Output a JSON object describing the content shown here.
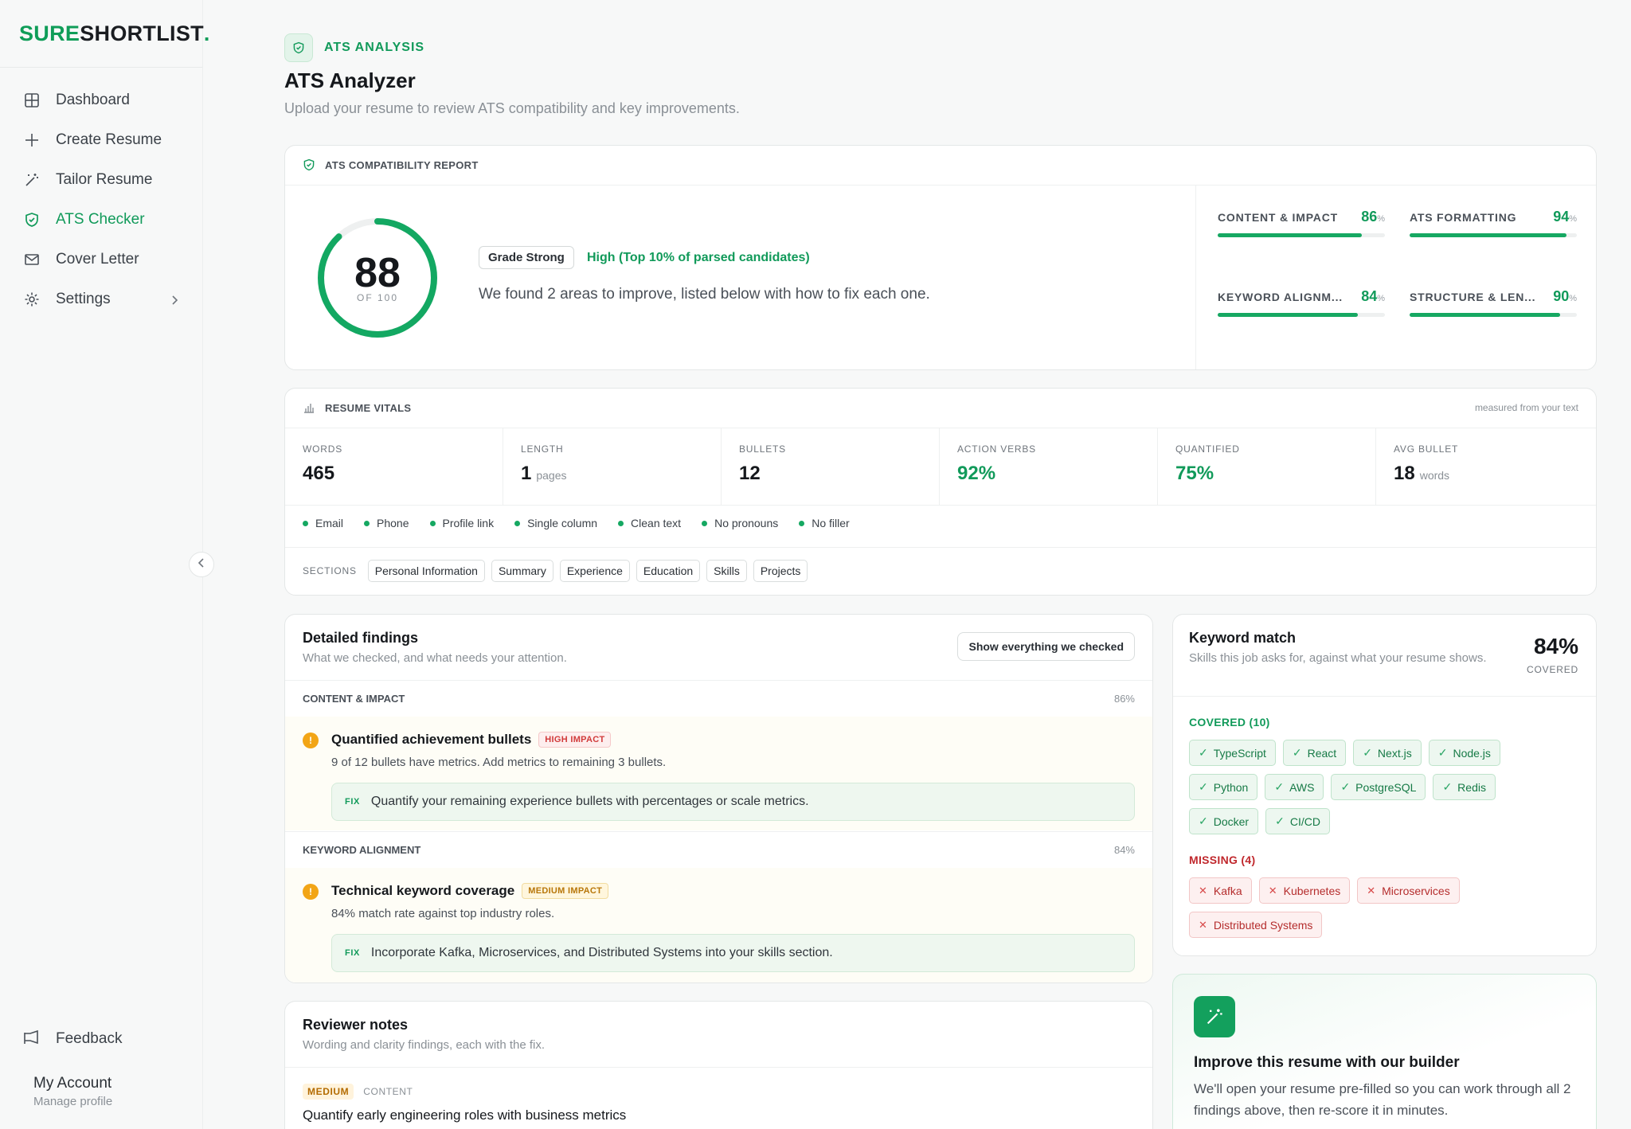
{
  "brand": {
    "part1": "SURE",
    "part2": "SHORTLIST",
    "dot": "."
  },
  "nav": [
    {
      "label": "Dashboard",
      "icon": "grid-icon"
    },
    {
      "label": "Create Resume",
      "icon": "plus-icon"
    },
    {
      "label": "Tailor Resume",
      "icon": "wand-icon"
    },
    {
      "label": "ATS Checker",
      "icon": "shield-icon",
      "active": true
    },
    {
      "label": "Cover Letter",
      "icon": "mail-icon"
    },
    {
      "label": "Settings",
      "icon": "gear-icon"
    }
  ],
  "sidebar_bottom": {
    "feedback": "Feedback",
    "account_title": "My Account",
    "account_sub": "Manage profile"
  },
  "header": {
    "kicker": "ATS ANALYSIS",
    "title": "ATS Analyzer",
    "subtitle": "Upload your resume to review ATS compatibility and key improvements."
  },
  "report": {
    "heading": "ATS COMPATIBILITY REPORT",
    "score": "88",
    "score_value": 88,
    "score_of": "OF 100",
    "grade": "Grade Strong",
    "grade_note": "High (Top 10% of parsed candidates)",
    "summary": "We found 2 areas to improve, listed below with how to fix each one.",
    "metrics": [
      {
        "label": "CONTENT & IMPACT",
        "value": "86",
        "pct": 86
      },
      {
        "label": "ATS FORMATTING",
        "value": "94",
        "pct": 94
      },
      {
        "label": "KEYWORD ALIGNM...",
        "value": "84",
        "pct": 84
      },
      {
        "label": "STRUCTURE & LEN...",
        "value": "90",
        "pct": 90
      }
    ],
    "percent_sign": "%"
  },
  "vitals": {
    "heading": "RESUME VITALS",
    "measured": "measured from your text",
    "cells": [
      {
        "label": "WORDS",
        "value": "465",
        "unit": ""
      },
      {
        "label": "LENGTH",
        "value": "1",
        "unit": "pages"
      },
      {
        "label": "BULLETS",
        "value": "12",
        "unit": ""
      },
      {
        "label": "ACTION VERBS",
        "value": "92%",
        "unit": ""
      },
      {
        "label": "QUANTIFIED",
        "value": "75%",
        "unit": ""
      },
      {
        "label": "AVG BULLET",
        "value": "18",
        "unit": "words"
      }
    ],
    "checks": [
      "Email",
      "Phone",
      "Profile link",
      "Single column",
      "Clean text",
      "No pronouns",
      "No filler"
    ],
    "sections_label": "SECTIONS",
    "sections": [
      "Personal Information",
      "Summary",
      "Experience",
      "Education",
      "Skills",
      "Projects"
    ]
  },
  "findings": {
    "title": "Detailed findings",
    "subtitle": "What we checked, and what needs your attention.",
    "button": "Show everything we checked",
    "groups": [
      {
        "section": "CONTENT & IMPACT",
        "pct": "86%",
        "item": "Quantified achievement bullets",
        "impact": "HIGH IMPACT",
        "desc": "9 of 12 bullets have metrics. Add metrics to remaining 3 bullets.",
        "fix_label": "FIX",
        "fix": "Quantify your remaining experience bullets with percentages or scale metrics."
      },
      {
        "section": "KEYWORD ALIGNMENT",
        "pct": "84%",
        "item": "Technical keyword coverage",
        "impact": "MEDIUM IMPACT",
        "desc": "84% match rate against top industry roles.",
        "fix_label": "FIX",
        "fix": "Incorporate Kafka, Microservices, and Distributed Systems into your skills section."
      }
    ]
  },
  "keywords": {
    "title": "Keyword match",
    "subtitle": "Skills this job asks for, against what your resume shows.",
    "percent": "84%",
    "covered_label": "COVERED",
    "covered_heading": "COVERED (10)",
    "covered": [
      "TypeScript",
      "React",
      "Next.js",
      "Node.js",
      "Python",
      "AWS",
      "PostgreSQL",
      "Redis",
      "Docker",
      "CI/CD"
    ],
    "missing_heading": "MISSING (4)",
    "missing": [
      "Kafka",
      "Kubernetes",
      "Microservices",
      "Distributed Systems"
    ]
  },
  "notes": {
    "title": "Reviewer notes",
    "subtitle": "Wording and clarity findings, each with the fix.",
    "severity": "MEDIUM",
    "category": "CONTENT",
    "headline": "Quantify early engineering roles with business metrics"
  },
  "improve": {
    "title": "Improve this resume with our builder",
    "desc": "We'll open your resume pre-filled so you can work through all 2 findings above, then re-score it in minutes."
  },
  "colors": {
    "accent": "#119a5a",
    "warning": "#f2a516",
    "danger": "#d13a3a"
  }
}
